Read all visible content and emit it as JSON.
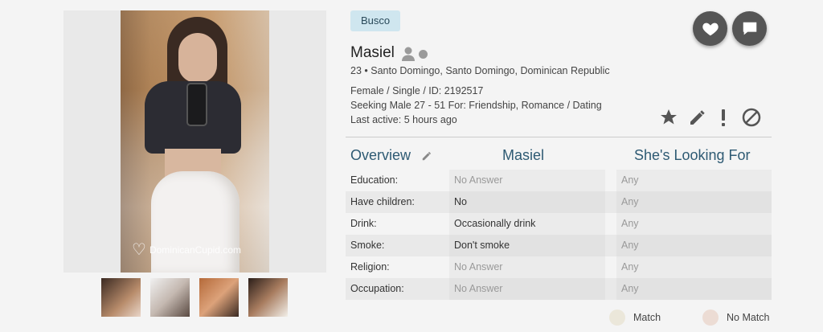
{
  "photo": {
    "watermark": "DominicanCupid.com"
  },
  "profile": {
    "badge": "Busco",
    "name": "Masiel",
    "location": "23 • Santo Domingo, Santo Domingo, Dominican Republic",
    "details": "Female / Single / ID: 2192517",
    "seeking": "Seeking Male 27 - 51 For: Friendship, Romance / Dating",
    "last_active": "Last active: 5 hours ago"
  },
  "table": {
    "headers": {
      "overview": "Overview",
      "her": "Masiel",
      "looking": "She's Looking For"
    },
    "rows": [
      {
        "label": "Education:",
        "value": "No Answer",
        "want": "Any"
      },
      {
        "label": "Have children:",
        "value": "No",
        "want": "Any"
      },
      {
        "label": "Drink:",
        "value": "Occasionally drink",
        "want": "Any"
      },
      {
        "label": "Smoke:",
        "value": "Don't smoke",
        "want": "Any"
      },
      {
        "label": "Religion:",
        "value": "No Answer",
        "want": "Any"
      },
      {
        "label": "Occupation:",
        "value": "No Answer",
        "want": "Any"
      }
    ]
  },
  "legend": {
    "match": "Match",
    "no_match": "No Match",
    "match_color": "#ebe7da",
    "no_match_color": "#ecdcd4"
  },
  "icons": [
    "heart-icon",
    "chat-icon",
    "person-icon",
    "star-icon",
    "pencil-icon",
    "exclamation-icon",
    "block-icon"
  ]
}
